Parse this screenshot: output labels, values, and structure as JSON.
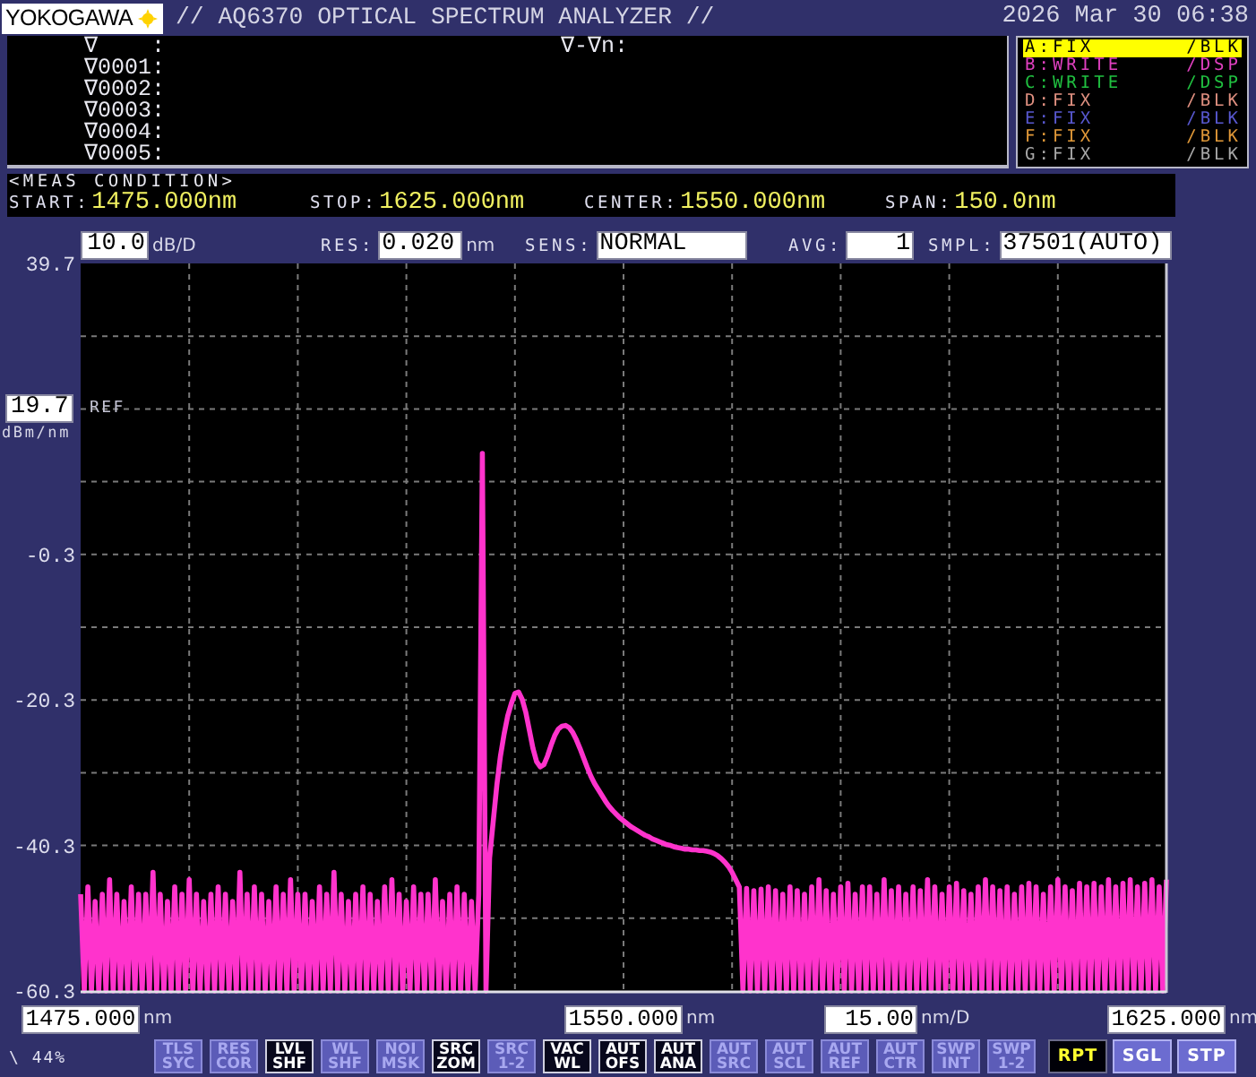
{
  "header": {
    "logo": "YOKOGAWA",
    "title": "// AQ6370 OPTICAL SPECTRUM ANALYZER //",
    "datetime": "2026 Mar 30 06:38"
  },
  "markers": {
    "rows": [
      "∇    :",
      "∇0001:",
      "∇0002:",
      "∇0003:",
      "∇0004:",
      "∇0005:"
    ],
    "delta_label": "∇-∇n:"
  },
  "traces": [
    {
      "name": "A:FIX",
      "mode": "/BLK",
      "color": "#ffff00",
      "selected": true
    },
    {
      "name": "B:WRITE",
      "mode": "/DSP",
      "color": "#e040c0",
      "selected": false
    },
    {
      "name": "C:WRITE",
      "mode": "/DSP",
      "color": "#20c040",
      "selected": false
    },
    {
      "name": "D:FIX",
      "mode": "/BLK",
      "color": "#e09080",
      "selected": false
    },
    {
      "name": "E:FIX",
      "mode": "/BLK",
      "color": "#5858d0",
      "selected": false
    },
    {
      "name": "F:FIX",
      "mode": "/BLK",
      "color": "#e09838",
      "selected": false
    },
    {
      "name": "G:FIX",
      "mode": "/BLK",
      "color": "#a8a8a8",
      "selected": false
    }
  ],
  "meas_condition": {
    "title": "<MEAS CONDITION>",
    "items": [
      {
        "label": "START:",
        "value": "1475.000nm"
      },
      {
        "label": "STOP:",
        "value": "1625.000nm"
      },
      {
        "label": "CENTER:",
        "value": "1550.000nm"
      },
      {
        "label": "SPAN:",
        "value": "150.0nm"
      }
    ]
  },
  "settings": [
    {
      "value": "10.0",
      "unit": "dB/D"
    },
    {
      "label": "RES:",
      "value": "0.020",
      "unit": "nm"
    },
    {
      "label": "SENS:",
      "value": "NORMAL"
    },
    {
      "label": "AVG:",
      "value": "1"
    },
    {
      "label": "SMPL:",
      "value": "37501(AUTO)"
    }
  ],
  "plot": {
    "ref": {
      "value": "19.7",
      "label": "REF",
      "unit": "dBm/nm"
    },
    "chart_data": {
      "type": "line",
      "grid": true,
      "xlim": [
        1475,
        1625
      ],
      "ylim": [
        -60.3,
        39.7
      ],
      "yticks": [
        39.7,
        -0.3,
        -20.3,
        -40.3,
        -60.3
      ],
      "xticks": [
        {
          "value": 1475,
          "label": "1475.000"
        },
        {
          "value": 1550,
          "label": "1550.000"
        },
        {
          "value": 1625,
          "label": "1625.000"
        }
      ],
      "x": [
        1475,
        1475.5,
        1476,
        1476.5,
        1477,
        1477.5,
        1478,
        1478.5,
        1479,
        1479.5,
        1480,
        1480.5,
        1481,
        1481.5,
        1482,
        1482.5,
        1483,
        1483.5,
        1484,
        1484.5,
        1485,
        1485.5,
        1486,
        1486.5,
        1487,
        1487.5,
        1488,
        1488.5,
        1489,
        1489.5,
        1490,
        1490.5,
        1491,
        1491.5,
        1492,
        1492.5,
        1493,
        1493.5,
        1494,
        1494.5,
        1495,
        1495.5,
        1496,
        1496.5,
        1497,
        1497.5,
        1498,
        1498.5,
        1499,
        1499.5,
        1500,
        1500.5,
        1501,
        1501.5,
        1502,
        1502.5,
        1503,
        1503.5,
        1504,
        1504.5,
        1505,
        1505.5,
        1506,
        1506.5,
        1507,
        1507.5,
        1508,
        1508.5,
        1509,
        1509.5,
        1510,
        1510.5,
        1511,
        1511.5,
        1512,
        1512.5,
        1513,
        1513.5,
        1514,
        1514.5,
        1515,
        1515.5,
        1516,
        1516.5,
        1517,
        1517.5,
        1518,
        1518.5,
        1519,
        1519.5,
        1520,
        1520.5,
        1521,
        1521.5,
        1522,
        1522.5,
        1523,
        1523.5,
        1524,
        1524.5,
        1525,
        1525.5,
        1526,
        1526.5,
        1527,
        1527.5,
        1528,
        1528.5,
        1529,
        1529.5,
        1530,
        1530.5,
        1531,
        1531.5,
        1532,
        1532.5,
        1533,
        1533.5,
        1534,
        1534.5,
        1535,
        1535.5,
        1536,
        1536.5,
        1537,
        1537.5,
        1538,
        1538.5,
        1539,
        1539.5,
        1540,
        1540.5,
        1541,
        1541.5,
        1542,
        1542.5,
        1543,
        1543.5,
        1544,
        1544.5,
        1545,
        1545.5,
        1546,
        1546.5,
        1547,
        1547.5,
        1548,
        1548.5,
        1549,
        1549.5,
        1550,
        1550.5,
        1551,
        1551.5,
        1552,
        1552.5,
        1553,
        1553.5,
        1554,
        1554.5,
        1555,
        1555.5,
        1556,
        1556.5,
        1557,
        1557.5,
        1558,
        1558.5,
        1559,
        1559.5,
        1560,
        1560.5,
        1561,
        1561.5,
        1562,
        1562.5,
        1563,
        1563.5,
        1564,
        1564.5,
        1565,
        1565.5,
        1566,
        1566.5,
        1567,
        1567.5,
        1568,
        1568.5,
        1569,
        1569.5,
        1570,
        1570.5,
        1571,
        1571.5,
        1572,
        1572.5,
        1573,
        1573.5,
        1574,
        1574.5,
        1575,
        1575.5,
        1576,
        1576.5,
        1577,
        1577.5,
        1578,
        1578.5,
        1579,
        1579.5,
        1580,
        1580.5,
        1581,
        1581.5,
        1582,
        1582.5,
        1583,
        1583.5,
        1584,
        1584.5,
        1585,
        1585.5,
        1586,
        1586.5,
        1587,
        1587.5,
        1588,
        1588.5,
        1589,
        1589.5,
        1590,
        1590.5,
        1591,
        1591.5,
        1592,
        1592.5,
        1593,
        1593.5,
        1594,
        1594.5,
        1595,
        1595.5,
        1596,
        1596.5,
        1597,
        1597.5,
        1598,
        1598.5,
        1599,
        1599.5,
        1600,
        1600.5,
        1601,
        1601.5,
        1602,
        1602.5,
        1603,
        1603.5,
        1604,
        1604.5,
        1605,
        1605.5,
        1606,
        1606.5,
        1607,
        1607.5,
        1608,
        1608.5,
        1609,
        1609.5,
        1610,
        1610.5,
        1611,
        1611.5,
        1612,
        1612.5,
        1613,
        1613.5,
        1614,
        1614.5,
        1615,
        1615.5,
        1616,
        1616.5,
        1617,
        1617.5,
        1618,
        1618.5,
        1619,
        1619.5,
        1620,
        1620.5,
        1621,
        1621.5,
        1622,
        1622.5,
        1623,
        1623.5,
        1624,
        1624.5,
        1625
      ],
      "series": [
        {
          "color": "#ff33cc",
          "values": [
            -47,
            -60.3,
            -46,
            -60.3,
            -48,
            -60.3,
            -47,
            -60.3,
            -45,
            -60.3,
            -47,
            -60.3,
            -48,
            -60.3,
            -46,
            -60.3,
            -47,
            -60.3,
            -47,
            -60.3,
            -44,
            -60.3,
            -47,
            -60.3,
            -48,
            -60.3,
            -46,
            -60.3,
            -47,
            -60.3,
            -45,
            -60.3,
            -47,
            -60.3,
            -48,
            -60.3,
            -47,
            -60.3,
            -46,
            -60.3,
            -47,
            -60.3,
            -48,
            -60.3,
            -44,
            -60.3,
            -47,
            -60.3,
            -46,
            -60.3,
            -47,
            -60.3,
            -48,
            -60.3,
            -46,
            -60.3,
            -47,
            -60.3,
            -45,
            -60.3,
            -47,
            -60.3,
            -47,
            -60.3,
            -48,
            -60.3,
            -46,
            -60.3,
            -47,
            -60.3,
            -44,
            -60.3,
            -47,
            -60.3,
            -48,
            -60.3,
            -47,
            -60.3,
            -46,
            -60.3,
            -47,
            -60.3,
            -48,
            -60.3,
            -46,
            -60.3,
            -45,
            -60.3,
            -47,
            -60.3,
            -48,
            -60.3,
            -46,
            -60.3,
            -47,
            -60.3,
            -47,
            -60.3,
            -45,
            -60.3,
            -48,
            -60.3,
            -47,
            -60.3,
            -46,
            -60.3,
            -47,
            -60.3,
            -48,
            -60.3,
            -47,
            13.6,
            -60.3,
            -42,
            -37,
            -32,
            -28,
            -25,
            -22.5,
            -20.8,
            -19.4,
            -19.2,
            -20.2,
            -22,
            -24.5,
            -27,
            -28.8,
            -29.5,
            -29.2,
            -28,
            -26.5,
            -25.2,
            -24.3,
            -23.9,
            -23.8,
            -24.1,
            -24.8,
            -25.8,
            -27,
            -28.3,
            -29.6,
            -30.8,
            -31.8,
            -32.6,
            -33.4,
            -34.2,
            -34.9,
            -35.5,
            -36,
            -36.5,
            -36.9,
            -37.3,
            -37.7,
            -38,
            -38.3,
            -38.6,
            -38.9,
            -39.1,
            -39.4,
            -39.6,
            -39.8,
            -40,
            -40.2,
            -40.3,
            -40.5,
            -40.6,
            -40.7,
            -40.8,
            -40.8,
            -40.9,
            -40.9,
            -41,
            -41,
            -41.1,
            -41.2,
            -41.4,
            -41.7,
            -42.1,
            -42.6,
            -43.2,
            -44,
            -45,
            -46,
            -60.3,
            -46.2,
            -60.3,
            -46.5,
            -60.3,
            -46.3,
            -60.3,
            -46,
            -60.3,
            -46.5,
            -60.3,
            -47,
            -60.3,
            -46,
            -60.3,
            -46.5,
            -60.3,
            -47,
            -60.3,
            -46,
            -60.3,
            -45,
            -60.3,
            -46.5,
            -60.3,
            -47,
            -60.3,
            -46,
            -60.3,
            -45.5,
            -60.3,
            -47,
            -60.3,
            -46,
            -60.3,
            -46,
            -60.3,
            -47,
            -60.3,
            -45,
            -60.3,
            -46.5,
            -60.3,
            -46,
            -60.3,
            -47,
            -60.3,
            -46,
            -60.3,
            -46.5,
            -60.3,
            -45,
            -60.3,
            -46,
            -60.3,
            -47,
            -60.3,
            -46,
            -60.3,
            -45.5,
            -60.3,
            -46.5,
            -60.3,
            -47,
            -60.3,
            -46,
            -60.3,
            -45,
            -60.3,
            -46,
            -60.3,
            -46.5,
            -60.3,
            -46,
            -60.3,
            -47,
            -60.3,
            -46,
            -60.3,
            -45.5,
            -60.3,
            -46,
            -60.3,
            -47,
            -60.3,
            -46,
            -60.3,
            -45,
            -60.3,
            -46,
            -60.3,
            -46.5,
            -60.3,
            -45.5,
            -60.3,
            -46,
            -60.3,
            -45.5,
            -60.3,
            -46,
            -60.3,
            -45,
            -60.3,
            -46,
            -60.3,
            -45.5,
            -60.3,
            -45,
            -60.3,
            -46,
            -60.3,
            -45.5,
            -60.3,
            -45,
            -60.3,
            -46,
            -60.3,
            -45
          ]
        }
      ]
    }
  },
  "x_axis": {
    "start_unit": "nm",
    "center_unit": "nm",
    "division": {
      "value": "15.00",
      "unit": "nm/D"
    },
    "stop_unit": "nm"
  },
  "status": "\\ 44%",
  "soft_keys": [
    {
      "label": "TLS SYC",
      "on": false
    },
    {
      "label": "RES COR",
      "on": false
    },
    {
      "label": "LVL SHF",
      "on": true
    },
    {
      "label": "WL SHF",
      "on": false
    },
    {
      "label": "NOI MSK",
      "on": false
    },
    {
      "label": "SRC ZOM",
      "on": true
    },
    {
      "label": "SRC 1-2",
      "on": false
    },
    {
      "label": "VAC WL",
      "on": true
    },
    {
      "label": "AUT OFS",
      "on": true
    },
    {
      "label": "AUT ANA",
      "on": true
    },
    {
      "label": "AUT SRC",
      "on": false
    },
    {
      "label": "AUT SCL",
      "on": false
    },
    {
      "label": "AUT REF",
      "on": false
    },
    {
      "label": "AUT CTR",
      "on": false
    },
    {
      "label": "SWP INT",
      "on": false
    },
    {
      "label": "SWP 1-2",
      "on": false
    }
  ],
  "sweep_keys": [
    {
      "label": "RPT",
      "selected": true
    },
    {
      "label": "SGL",
      "selected": false
    },
    {
      "label": "STP",
      "selected": false
    }
  ]
}
